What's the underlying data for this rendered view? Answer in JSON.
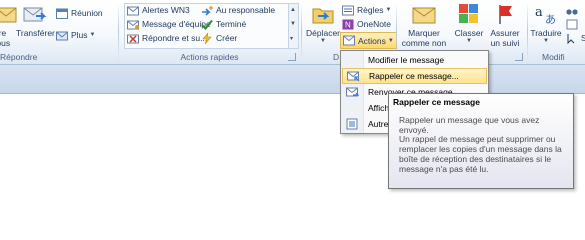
{
  "groups": {
    "repondre": {
      "label": "Répondre",
      "buttons": {
        "repondre_a_tous": "dre\ntous",
        "transferer": "Transférer",
        "reunion": "Réunion",
        "plus": "Plus"
      }
    },
    "actions_rapides": {
      "label": "Actions rapides",
      "items": [
        "Alertes WN3",
        "Message d'équipe",
        "Répondre et su...",
        "Au responsable",
        "Terminé",
        "Créer"
      ]
    },
    "deplacer": {
      "label": "D",
      "deplacer": "Déplacer",
      "regles": "Règles",
      "onenote": "OneNote",
      "actions": "Actions"
    },
    "indicateurs": {
      "label": "",
      "marquer": "Marquer comme non lu",
      "classer": "Classer",
      "assurer": "Assurer un suivi"
    },
    "modification": {
      "label": "Modifi",
      "traduire": "Traduire",
      "s": "S"
    }
  },
  "menu": {
    "items": [
      {
        "label": "Modifier le message",
        "icon": "blank"
      },
      {
        "label": "Rappeler ce message...",
        "icon": "recall-icon"
      },
      {
        "label": "Renvoyer ce message...",
        "icon": "resend-icon"
      },
      {
        "label": "Affich",
        "icon": "blank"
      },
      {
        "label": "Autre",
        "icon": "other-actions-icon"
      }
    ]
  },
  "tooltip": {
    "title": "Rappeler ce message",
    "description": "Rappeler un message que vous avez envoyé.",
    "body": "Un rappel de message peut supprimer ou remplacer les copies d'un message dans la boîte de réception des destinataires si le message n'a pas été lu."
  },
  "colors": {
    "ribbon_text": "#1e395b",
    "highlight": "#ffe38c",
    "band": "#c7d6ea"
  }
}
